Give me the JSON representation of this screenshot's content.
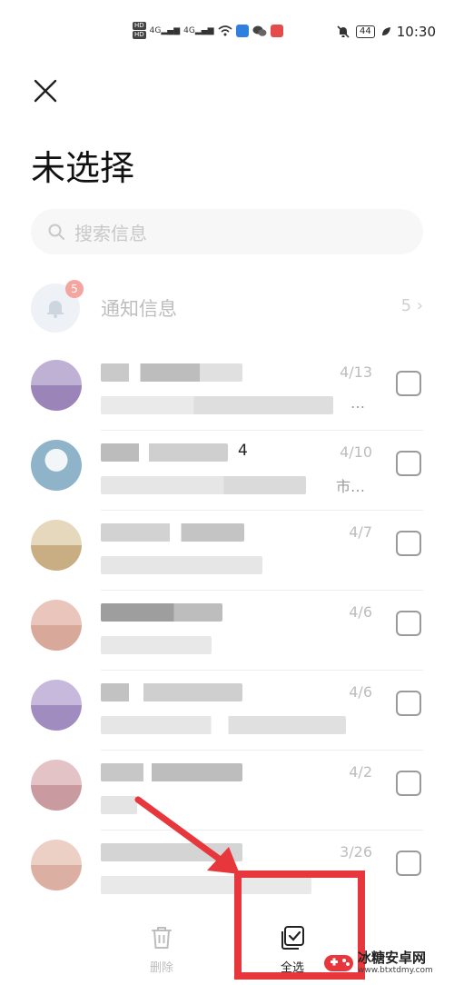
{
  "status_bar": {
    "time": "10:30",
    "battery": "44",
    "network_1": "4G",
    "network_2": "4G",
    "hd_1": "HD",
    "hd_2": "HD"
  },
  "header": {
    "title": "未选择"
  },
  "search": {
    "placeholder": "搜索信息"
  },
  "notification": {
    "label": "通知信息",
    "badge": "5",
    "count": "5"
  },
  "messages": [
    {
      "date": "4/13",
      "snippet": "…",
      "avatar_color": "#9b84b8"
    },
    {
      "date": "4/10",
      "title_fragment": "4",
      "snippet": "市…",
      "avatar_color": "#8fb3c8"
    },
    {
      "date": "4/7",
      "snippet": "",
      "avatar_color": "#c8ae82"
    },
    {
      "date": "4/6",
      "snippet": "",
      "avatar_color": "#d8a89a"
    },
    {
      "date": "4/6",
      "snippet": "",
      "avatar_color": "#a08cbf"
    },
    {
      "date": "4/2",
      "snippet": "",
      "avatar_color": "#c99aa0"
    },
    {
      "date": "3/26",
      "snippet": "",
      "avatar_color": "#dbb0a2"
    }
  ],
  "toolbar": {
    "delete_label": "删除",
    "select_all_label": "全选"
  },
  "watermark": {
    "name": "冰糖安卓网",
    "url": "www.btxtdmy.com"
  },
  "colors": {
    "highlight": "#e8373c",
    "text_muted": "#bdbdbd"
  }
}
